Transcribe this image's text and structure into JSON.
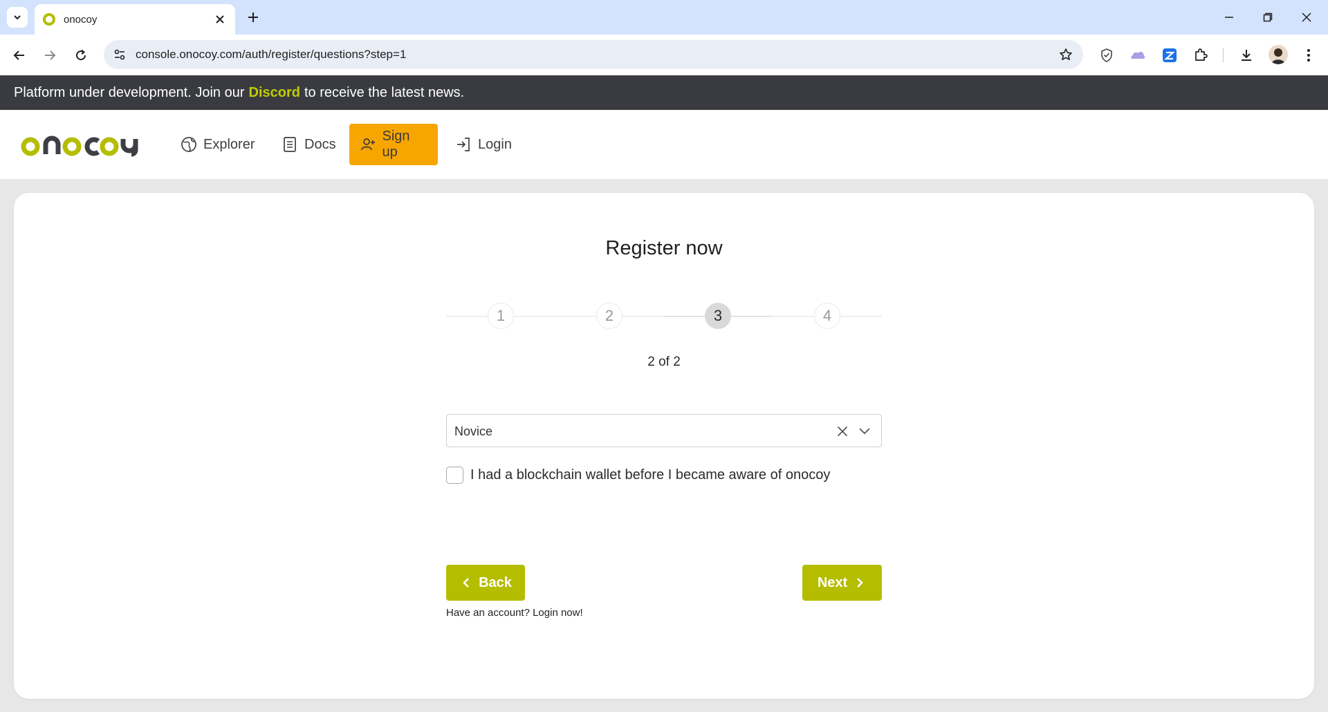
{
  "browser": {
    "tab_title": "onocoy",
    "url": "console.onocoy.com/auth/register/questions?step=1"
  },
  "banner": {
    "prefix": "Platform under development. Join our",
    "link": "Discord",
    "suffix": "to receive the latest news."
  },
  "nav": {
    "logo_text": "onocoy",
    "items": [
      {
        "label": "Explorer",
        "icon": "globe-icon"
      },
      {
        "label": "Docs",
        "icon": "document-icon"
      },
      {
        "label": "Sign up",
        "icon": "add-user-icon",
        "active": true
      },
      {
        "label": "Login",
        "icon": "login-icon"
      }
    ]
  },
  "register": {
    "title": "Register now",
    "steps": [
      "1",
      "2",
      "3",
      "4"
    ],
    "current_step": 3,
    "caption": "2 of 2",
    "select_value": "Novice",
    "checkbox_label": "I had a blockchain wallet before I became aware of onocoy",
    "checkbox_checked": false,
    "back_label": "Back",
    "next_label": "Next",
    "login_hint": "Have an account? Login now!"
  },
  "colors": {
    "brand": "#b5bd00",
    "signup": "#f7a600",
    "banner_bg": "#393b40"
  }
}
